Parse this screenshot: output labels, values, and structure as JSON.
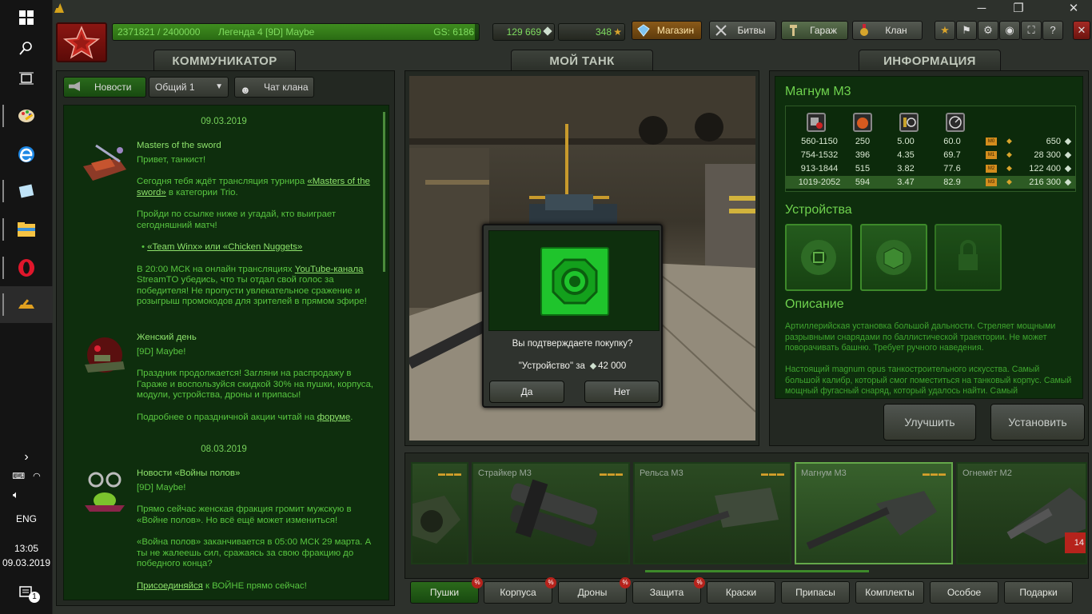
{
  "taskbar": {
    "lang": "ENG",
    "time": "13:05",
    "date": "09.03.2019",
    "notif_count": "1"
  },
  "topbar": {
    "xp_text": "2371821 / 2400000",
    "rank_text": "Легенда 4 [9D] Maybe",
    "gs_text": "GS: 6186",
    "xp_progress": 0.988,
    "crystals": "129 669",
    "stars": "348",
    "shop_label": "Магазин",
    "battles_label": "Битвы",
    "garage_label": "Гараж",
    "clan_label": "Клан"
  },
  "communicator": {
    "tab": "КОММУНИКАТОР",
    "news_btn": "Новости",
    "channel_select": "Общий 1",
    "clan_chat_btn": "Чат клана",
    "news": [
      {
        "date": "09.03.2019",
        "title": "Masters of the sword",
        "author": "Привет, танкист!",
        "p1_a": "Сегодня тебя ждёт трансляция турнира ",
        "p1_link": "«Masters of the sword»",
        "p1_b": " в категории Trio.",
        "p2": "Пройди по ссылке ниже и угадай, кто выиграет сегодняшний матч!",
        "bullet": "«Team Winx» или «Chicken Nuggets»",
        "p3_a": "В 20:00 МСК на онлайн трансляциях ",
        "p3_link": "YouTube-канала",
        "p3_b": " StreamTO убедись, что ты отдал свой голос за победителя! Не пропусти увлекательное сражение и розыгрыш промокодов для зрителей в прямом эфире!"
      },
      {
        "title": "Женский день",
        "author": "[9D] Maybe!",
        "p1": "Праздник продолжается! Загляни на распродажу в Гараже и воспользуйся скидкой 30% на пушки, корпуса, модули, устройства, дроны и припасы!",
        "p2_a": "Подробнее о праздничной акции читай на ",
        "p2_link": "форуме",
        "p2_b": "."
      },
      {
        "date": "08.03.2019",
        "title": "Новости «Войны полов»",
        "author": "[9D] Maybe!",
        "p1": "Прямо сейчас женская фракция громит мужскую в «Войне полов». Но всё ещё может измениться!",
        "p2": "«Война полов» заканчивается в 05:00 МСК 29 марта. А ты не жалеешь сил, сражаясь за свою фракцию до победного конца?",
        "p3_link": "Присоединяйся",
        "p3_b": " к ВОЙНЕ прямо сейчас!"
      }
    ]
  },
  "my_tank": {
    "tab": "МОЙ ТАНК"
  },
  "dialog": {
    "question": "Вы подтверждаете покупку?",
    "item": "\"Устройство\" за",
    "price": "42 000",
    "yes": "Да",
    "no": "Нет"
  },
  "info": {
    "tab": "ИНФОРМАЦИЯ",
    "item_name": "Магнум М3",
    "rows": [
      {
        "dmg": "560-1150",
        "a": "250",
        "b": "5.00",
        "c": "60.0",
        "mk": "M0",
        "price": "650"
      },
      {
        "dmg": "754-1532",
        "a": "396",
        "b": "4.35",
        "c": "69.7",
        "mk": "M1",
        "price": "28 300"
      },
      {
        "dmg": "913-1844",
        "a": "515",
        "b": "3.82",
        "c": "77.6",
        "mk": "M2",
        "price": "122 400"
      },
      {
        "dmg": "1019-2052",
        "a": "594",
        "b": "3.47",
        "c": "82.9",
        "mk": "M3",
        "price": "216 300"
      }
    ],
    "devices_title": "Устройства",
    "desc_title": "Описание",
    "desc_p1": "Артиллерийская установка большой дальности. Стреляет мощными разрывными снарядами по баллистической траектории. Не может поворачивать башню. Требует ручного наведения.",
    "desc_p2": "Настоящий magnum opus танкостроительного искусства. Самый большой калибр, который смог поместиться на танковый корпус. Самый мощный фугасный снаряд, который удалось найти. Самый",
    "upgrade_btn": "Улучшить",
    "install_btn": "Установить"
  },
  "cards": [
    {
      "name": ""
    },
    {
      "name": "Страйкер М3"
    },
    {
      "name": "Рельса М3"
    },
    {
      "name": "Магнум М3"
    },
    {
      "name": "Огнемёт М2",
      "badge": "14"
    }
  ],
  "categories": [
    {
      "label": "Пушки"
    },
    {
      "label": "Корпуса"
    },
    {
      "label": "Дроны"
    },
    {
      "label": "Защита"
    },
    {
      "label": "Краски"
    },
    {
      "label": "Припасы"
    },
    {
      "label": "Комплекты"
    },
    {
      "label": "Особое"
    },
    {
      "label": "Подарки"
    }
  ],
  "sale_badge": "%",
  "colors": {
    "accent_green": "#58c640",
    "panel_green": "#0e2e0d",
    "shop_orange": "#8a5a19"
  }
}
